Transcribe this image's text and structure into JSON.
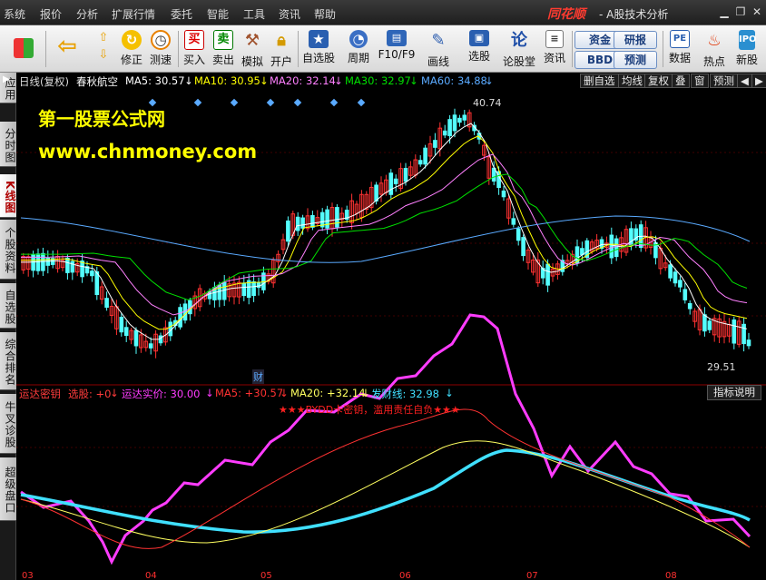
{
  "menu": {
    "items": [
      "系统",
      "报价",
      "分析",
      "扩展行情",
      "委托",
      "智能",
      "工具",
      "资讯",
      "帮助"
    ],
    "brand": "同花顺",
    "subtitle": "- A股技术分析"
  },
  "toolbar": {
    "buttons": [
      "修正",
      "测速",
      "买入",
      "卖出",
      "模拟",
      "开户",
      "自选股",
      "周期",
      "F10/F9",
      "画线",
      "选股",
      "论股堂",
      "资讯",
      "数据",
      "热点",
      "新股"
    ],
    "small_buttons": [
      "资金",
      "研报",
      "BBD",
      "预测"
    ]
  },
  "sidetabs": [
    "应用",
    "分时图",
    "K线图",
    "个股资料",
    "自选股",
    "综合排名",
    "牛叉诊股",
    "超级盘口"
  ],
  "chart_header": {
    "period": "日线(复权)",
    "stock": "春秋航空",
    "ma5": "MA5: 30.57",
    "ma10": "MA10: 30.95",
    "ma20": "MA20: 32.14",
    "ma30": "MA30: 32.97",
    "ma60": "MA60: 34.88",
    "right_buttons": [
      "删自选",
      "均线",
      "复权",
      "叠",
      "窗",
      "预测"
    ]
  },
  "watermark": {
    "line1": "第一股票公式网",
    "line2": "www.chnmoney.com"
  },
  "price_labels": {
    "high": "40.74",
    "low": "29.51",
    "marker": "财"
  },
  "indicator_header": {
    "name": "运达密钥",
    "select": "选股: +0",
    "real_price": "运达实价: 30.00",
    "ma5": "MA5: +30.57",
    "ma20": "MA20: +32.14",
    "fa_cai": "发财线: 32.98",
    "button": "指标说明",
    "note": "★★★BYDD卡密钥，滥用责任自负★★★"
  },
  "x_axis": [
    "03",
    "04",
    "05",
    "06",
    "07",
    "08"
  ],
  "colors": {
    "up": "#ff3232",
    "down": "#54ffff",
    "ma5": "#ffffff",
    "ma10": "#ffff00",
    "ma20": "#ff80ff",
    "ma30": "#00e000",
    "ma60": "#5aaaff",
    "indicator_main": "#ff3cff",
    "indicator_slow": "#40e0ff"
  }
}
